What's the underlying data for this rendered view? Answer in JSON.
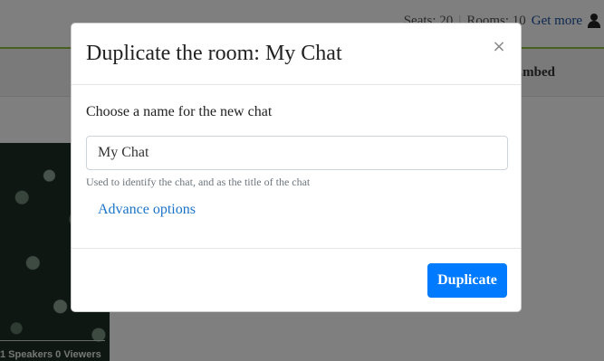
{
  "topbar": {
    "seats": "Seats: 20",
    "separator": "|",
    "rooms": "Rooms: 10",
    "get_more": "Get more",
    "user_icon": "user-icon"
  },
  "subnav": {
    "embed_tab": "Embed"
  },
  "room_card": {
    "stats": "1  Speakers  0  Viewers"
  },
  "modal": {
    "title": "Duplicate the room: My Chat",
    "close_symbol": "×",
    "name_label": "Choose a name for the new chat",
    "name_value": "My Chat",
    "help_text": "Used to identify the chat, and as the title of the chat",
    "advance_link": "Advance options",
    "duplicate_label": "Duplicate"
  },
  "colors": {
    "accent": "#007bff",
    "link": "#1a73c8",
    "topbar_border": "#8fbf3f"
  }
}
